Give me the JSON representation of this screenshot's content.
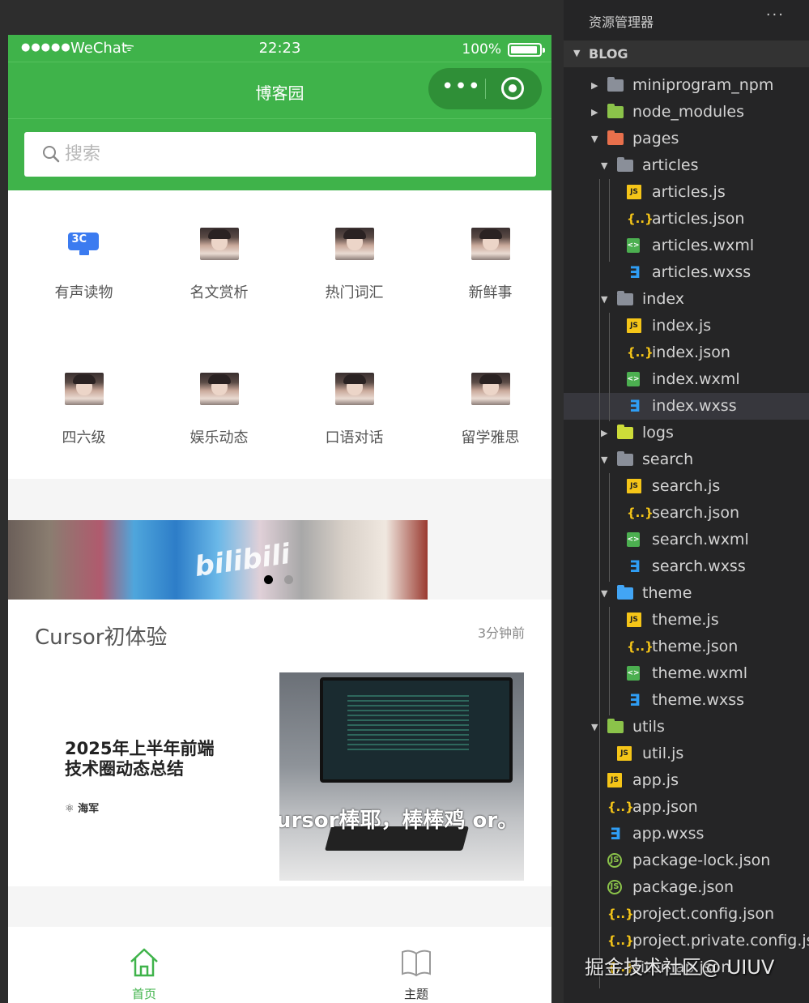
{
  "status_bar": {
    "signal": "●●●●●",
    "carrier": "WeChat",
    "wifi": "ᯤ",
    "time": "22:23",
    "battery": "100%"
  },
  "nav": {
    "title": "博客园",
    "more": "•••"
  },
  "search": {
    "placeholder": "搜索"
  },
  "categories": [
    {
      "label": "有声读物",
      "icon": "3c-device-icon",
      "badge": "3C"
    },
    {
      "label": "名文赏析",
      "icon": "portrait-icon"
    },
    {
      "label": "热门词汇",
      "icon": "portrait-icon"
    },
    {
      "label": "新鲜事",
      "icon": "portrait-icon"
    },
    {
      "label": "四六级",
      "icon": "portrait-icon"
    },
    {
      "label": "娱乐动态",
      "icon": "portrait-icon"
    },
    {
      "label": "口语对话",
      "icon": "portrait-icon"
    },
    {
      "label": "留学雅思",
      "icon": "portrait-icon"
    }
  ],
  "banner": {
    "sign_text": "bilibili",
    "active_dot": 0,
    "dot_count": 2
  },
  "article": {
    "title": "Cursor初体验",
    "time": "3分钟前",
    "thumb1_heading": "2025年上半年前端\n技术圈动态总结",
    "thumb1_author": "⚛ 海军",
    "thumb2_overlay": "ursor棒耶，棒棒鸡\nor。"
  },
  "tabbar": [
    {
      "label": "首页",
      "icon": "home-icon",
      "active": true
    },
    {
      "label": "主题",
      "icon": "book-icon",
      "active": false
    }
  ],
  "colors": {
    "wechat_green": "#3fb34a",
    "tab_active": "#3fb34a",
    "tab_inactive": "#333333"
  },
  "explorer": {
    "header": "资源管理器",
    "menu": "···",
    "section": "BLOG",
    "tree": [
      {
        "name": "miniprogram_npm",
        "type": "folder",
        "icon": "f-npm"
      },
      {
        "name": "node_modules",
        "type": "folder",
        "icon": "f-node"
      },
      {
        "name": "pages",
        "type": "folder",
        "icon": "f-pages"
      },
      {
        "name": "articles",
        "type": "folder",
        "icon": "folder"
      },
      {
        "name": "articles.js",
        "type": "js"
      },
      {
        "name": "articles.json",
        "type": "json"
      },
      {
        "name": "articles.wxml",
        "type": "wxml"
      },
      {
        "name": "articles.wxss",
        "type": "wxss"
      },
      {
        "name": "index",
        "type": "folder",
        "icon": "folder"
      },
      {
        "name": "index.js",
        "type": "js"
      },
      {
        "name": "index.json",
        "type": "json"
      },
      {
        "name": "index.wxml",
        "type": "wxml"
      },
      {
        "name": "index.wxss",
        "type": "wxss",
        "selected": true
      },
      {
        "name": "logs",
        "type": "folder",
        "icon": "f-logs"
      },
      {
        "name": "search",
        "type": "folder",
        "icon": "folder"
      },
      {
        "name": "search.js",
        "type": "js"
      },
      {
        "name": "search.json",
        "type": "json"
      },
      {
        "name": "search.wxml",
        "type": "wxml"
      },
      {
        "name": "search.wxss",
        "type": "wxss"
      },
      {
        "name": "theme",
        "type": "folder",
        "icon": "f-theme"
      },
      {
        "name": "theme.js",
        "type": "js"
      },
      {
        "name": "theme.json",
        "type": "json"
      },
      {
        "name": "theme.wxml",
        "type": "wxml"
      },
      {
        "name": "theme.wxss",
        "type": "wxss"
      },
      {
        "name": "utils",
        "type": "folder",
        "icon": "f-utils"
      },
      {
        "name": "util.js",
        "type": "js"
      },
      {
        "name": "app.js",
        "type": "js"
      },
      {
        "name": "app.json",
        "type": "json"
      },
      {
        "name": "app.wxss",
        "type": "wxss"
      },
      {
        "name": "package-lock.json",
        "type": "pkg"
      },
      {
        "name": "package.json",
        "type": "pkg"
      },
      {
        "name": "project.config.json",
        "type": "json"
      },
      {
        "name": "project.private.config.js...",
        "type": "json"
      },
      {
        "name": "sitemap.json",
        "type": "json"
      }
    ],
    "watermark": "掘金技术社区@ UIUV"
  }
}
